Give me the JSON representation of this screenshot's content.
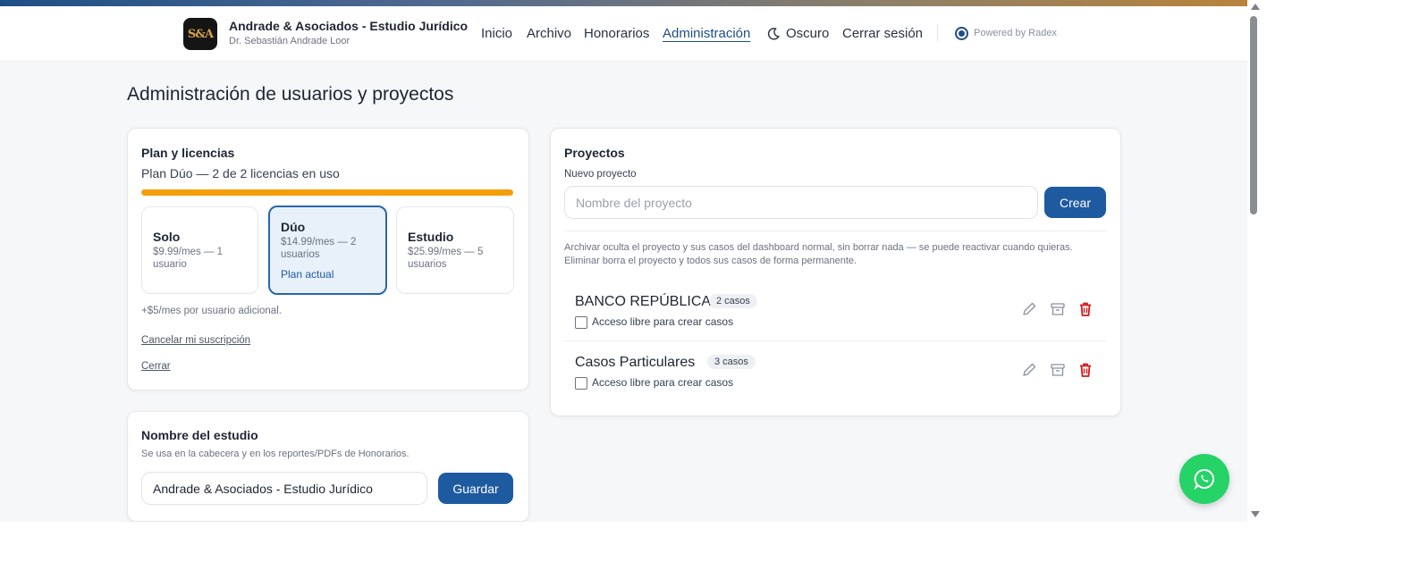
{
  "header": {
    "brand_title": "Andrade & Asociados - Estudio Jurídico",
    "brand_subtitle": "Dr. Sebastián Andrade Loor",
    "logo_text": "S&A",
    "nav": {
      "inicio": "Inicio",
      "archivo": "Archivo",
      "honorarios": "Honorarios",
      "administracion": "Administración",
      "theme": "Oscuro",
      "logout": "Cerrar sesión"
    },
    "powered_by": "Powered by Radex"
  },
  "page": {
    "title": "Administración de usuarios y proyectos"
  },
  "plan": {
    "title": "Plan y licencias",
    "summary": "Plan Dúo — 2 de 2 licencias en uso",
    "usage_fraction": 1.0,
    "options": [
      {
        "name": "Solo",
        "price": "$9.99/mes — 1 usuario"
      },
      {
        "name": "Dúo",
        "price": "$14.99/mes — 2 usuarios",
        "tag": "Plan actual"
      },
      {
        "name": "Estudio",
        "price": "$25.99/mes — 5 usuarios"
      }
    ],
    "extra_note": "+$5/mes por usuario adicional.",
    "cancel_link": "Cancelar mi suscripción",
    "close_link": "Cerrar"
  },
  "studio": {
    "title": "Nombre del estudio",
    "description": "Se usa en la cabecera y en los reportes/PDFs de Honorarios.",
    "name_value": "Andrade & Asociados - Estudio Jurídico",
    "save_label": "Guardar"
  },
  "projects": {
    "title": "Proyectos",
    "new_label": "Nuevo proyecto",
    "name_placeholder": "Nombre del proyecto",
    "create_label": "Crear",
    "help_text": "Archivar oculta el proyecto y sus casos del dashboard normal, sin borrar nada — se puede reactivar cuando quieras. Eliminar borra el proyecto y todos sus casos de forma permanente.",
    "items": [
      {
        "name": "BANCO REPÚBLICA",
        "count": "2 casos",
        "checkbox_label": "Acceso libre para crear casos",
        "checked": false
      },
      {
        "name": "Casos Particulares",
        "count": "3 casos",
        "checkbox_label": "Acceso libre para crear casos",
        "checked": false
      }
    ]
  },
  "colors": {
    "accent": "#1e5aa0",
    "progress": "#f59e0b",
    "danger": "#d11a1a",
    "whatsapp": "#25d366"
  },
  "icons": [
    "moon-icon",
    "radio-dot-icon",
    "pencil-icon",
    "archive-icon",
    "trash-icon",
    "whatsapp-icon"
  ]
}
